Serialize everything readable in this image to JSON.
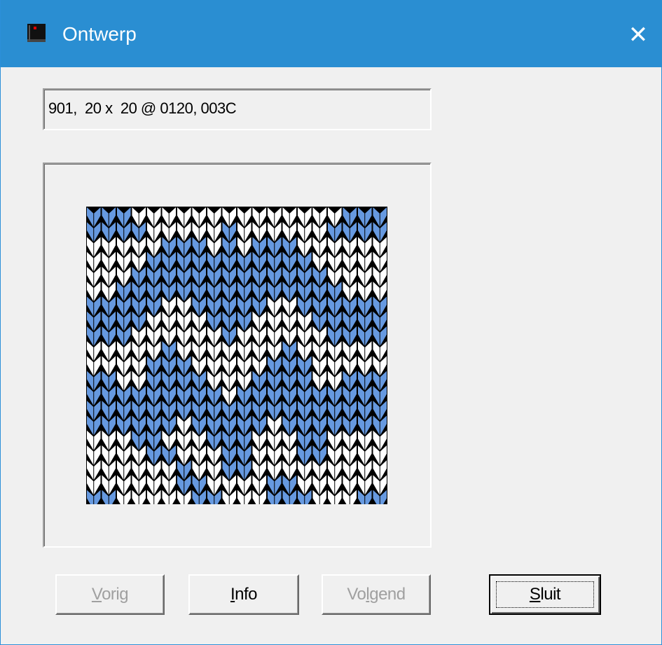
{
  "window": {
    "title": "Ontwerp",
    "close_glyph": "✕",
    "app_icon": "knitting-app-icon"
  },
  "info_field": {
    "value": "901,  20 x  20 @ 0120, 003C"
  },
  "pattern": {
    "description_colors": {
      "blue": "#6699e0",
      "white": "#ffffff",
      "line": "#000000"
    },
    "columns": 20,
    "rows": 20,
    "cells": [
      "BBBWWWWWWWWWWWWWWBBB",
      "BBBBWWWWWBWWWWWWBBBB",
      "WWWWWBBBWBWBBBWWWWWW",
      "WWWWBBBBBBBBBBBWWWWW",
      "WWWBBBBBBBBBBBBBWWWW",
      "WWBBBBBBBBBBBBBBBWWW",
      "BBBBBWWBBBBBWWBBBBBB",
      "BBBBWWWWBBBWWWWBBBBB",
      "BBBWWWWWWBWWWWWWBBBB",
      "WWWWWBWWWWWWWBWWWWWW",
      "WWWWBBBWWWWWBBBWWWWW",
      "BBWWBBBBWWWBBBBWWBBB",
      "BBBBBBBBBWBBBBBBBBBB",
      "BBBBBBBBBBBBBBBBBBBB",
      "BBBBBBWBBBBBWBBBBBBB",
      "WWWBBWWWBBBWWWBBWWWW",
      "WWWWBBWWWBBWWWBBWWWW",
      "WWWWWWBWWBBWWWWWWWWW",
      "WWWWWWBBWWWWBBWWWWWW",
      "BBWWWWWBBWWWBBBWWWBB"
    ]
  },
  "buttons": {
    "prev": {
      "accel": "V",
      "rest": "orig"
    },
    "info": {
      "accel": "I",
      "rest": "nfo"
    },
    "next": {
      "pre": "Vo",
      "accel": "l",
      "rest": "gend"
    },
    "close": {
      "accel": "S",
      "rest": "luit"
    }
  }
}
